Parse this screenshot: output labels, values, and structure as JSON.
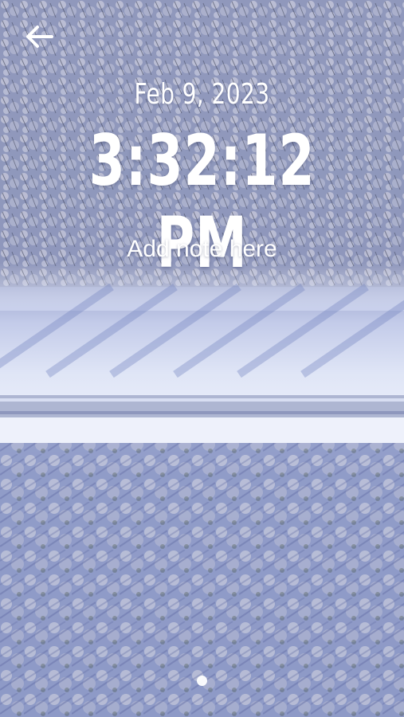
{
  "header": {
    "back_icon": "arrow-left-icon"
  },
  "clock": {
    "date": "Feb 9, 2023",
    "time": "3:32:12 PM"
  },
  "note": {
    "placeholder": "Add note here"
  },
  "pager": {
    "page_count": 1,
    "active_index": 0
  },
  "colors": {
    "text": "#ffffff",
    "snow": "#e4e9f7",
    "shadow": "#7d8fc7",
    "trees": "#a9afc8"
  }
}
